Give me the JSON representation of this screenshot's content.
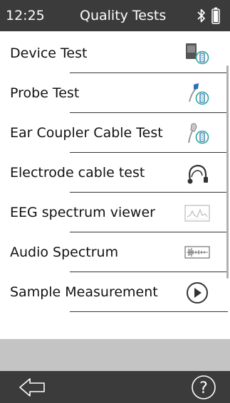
{
  "status_bar": {
    "time": "12:25",
    "title": "Quality Tests",
    "bluetooth_icon": "bluetooth-icon",
    "battery_icon": "battery-icon"
  },
  "tests": [
    {
      "label": "Device Test",
      "icon": "device-test-icon"
    },
    {
      "label": "Probe Test",
      "icon": "probe-test-icon"
    },
    {
      "label": "Ear Coupler Cable Test",
      "icon": "ear-coupler-cable-icon"
    },
    {
      "label": "Electrode cable test",
      "icon": "electrode-cable-icon"
    },
    {
      "label": "EEG spectrum viewer",
      "icon": "eeg-spectrum-icon"
    },
    {
      "label": "Audio Spectrum",
      "icon": "audio-spectrum-icon"
    },
    {
      "label": "Sample Measurement",
      "icon": "play-circle-icon"
    }
  ],
  "bottom_bar": {
    "back_icon": "back-arrow-icon",
    "help_icon": "help-icon",
    "help_glyph": "?"
  },
  "colors": {
    "bar_background": "#3b3b3b",
    "gray_band": "#c4c4c4",
    "accent_teal": "#2aa89a",
    "accent_blue": "#2f6fb3"
  }
}
